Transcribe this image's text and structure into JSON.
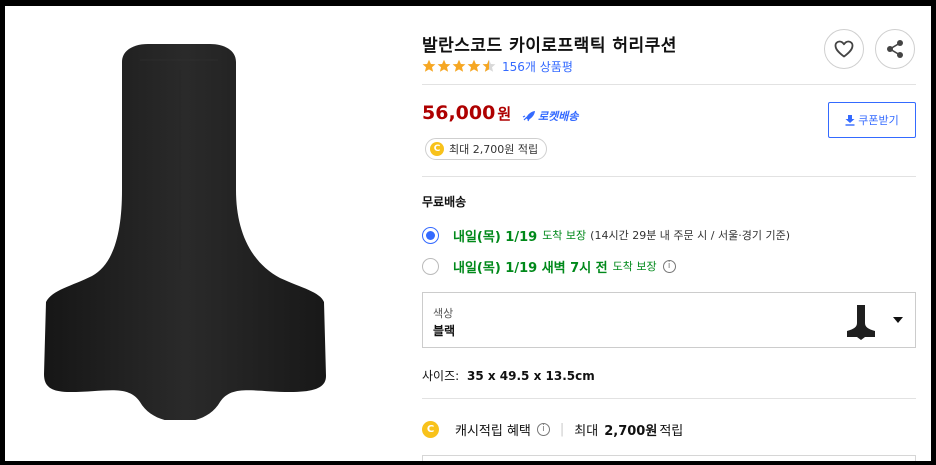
{
  "product": {
    "title": "발란스코드 카이로프랙틱 허리쿠션",
    "rating_stars": 4.5,
    "review_count": "156개 상품평"
  },
  "actions": {
    "wishlist_icon": "heart-icon",
    "share_icon": "share-icon"
  },
  "price": {
    "amount": "56,000",
    "unit": "원",
    "delivery_badge": "로켓배송",
    "coupon_label": "쿠폰받기",
    "points_pill": "최대 2,700원 적립",
    "coin_glyph": "C"
  },
  "shipping": {
    "free_label": "무료배송",
    "options": [
      {
        "selected": true,
        "date": "내일(목) 1/19",
        "suffix": "도착 보장",
        "note": "(14시간 29분 내 주문 시 / 서울·경기 기준)"
      },
      {
        "selected": false,
        "date": "내일(목) 1/19 새벽 7시 전",
        "suffix": "도착 보장",
        "info": "i"
      }
    ]
  },
  "option_select": {
    "label": "색상",
    "value": "블랙"
  },
  "size": {
    "label": "사이즈:",
    "value": "35 x 49.5 x 13.5cm"
  },
  "cash_benefit": {
    "label": "캐시적립 혜택",
    "info": "i",
    "prefix": "최대",
    "amount": "2,700원",
    "suffix": "적립"
  },
  "colors": {
    "price_red": "#ae0000",
    "link_blue": "#346aff",
    "delivery_green": "#00891a",
    "coin_gold": "#f8c21b",
    "product_black": "#1f1f1f"
  }
}
